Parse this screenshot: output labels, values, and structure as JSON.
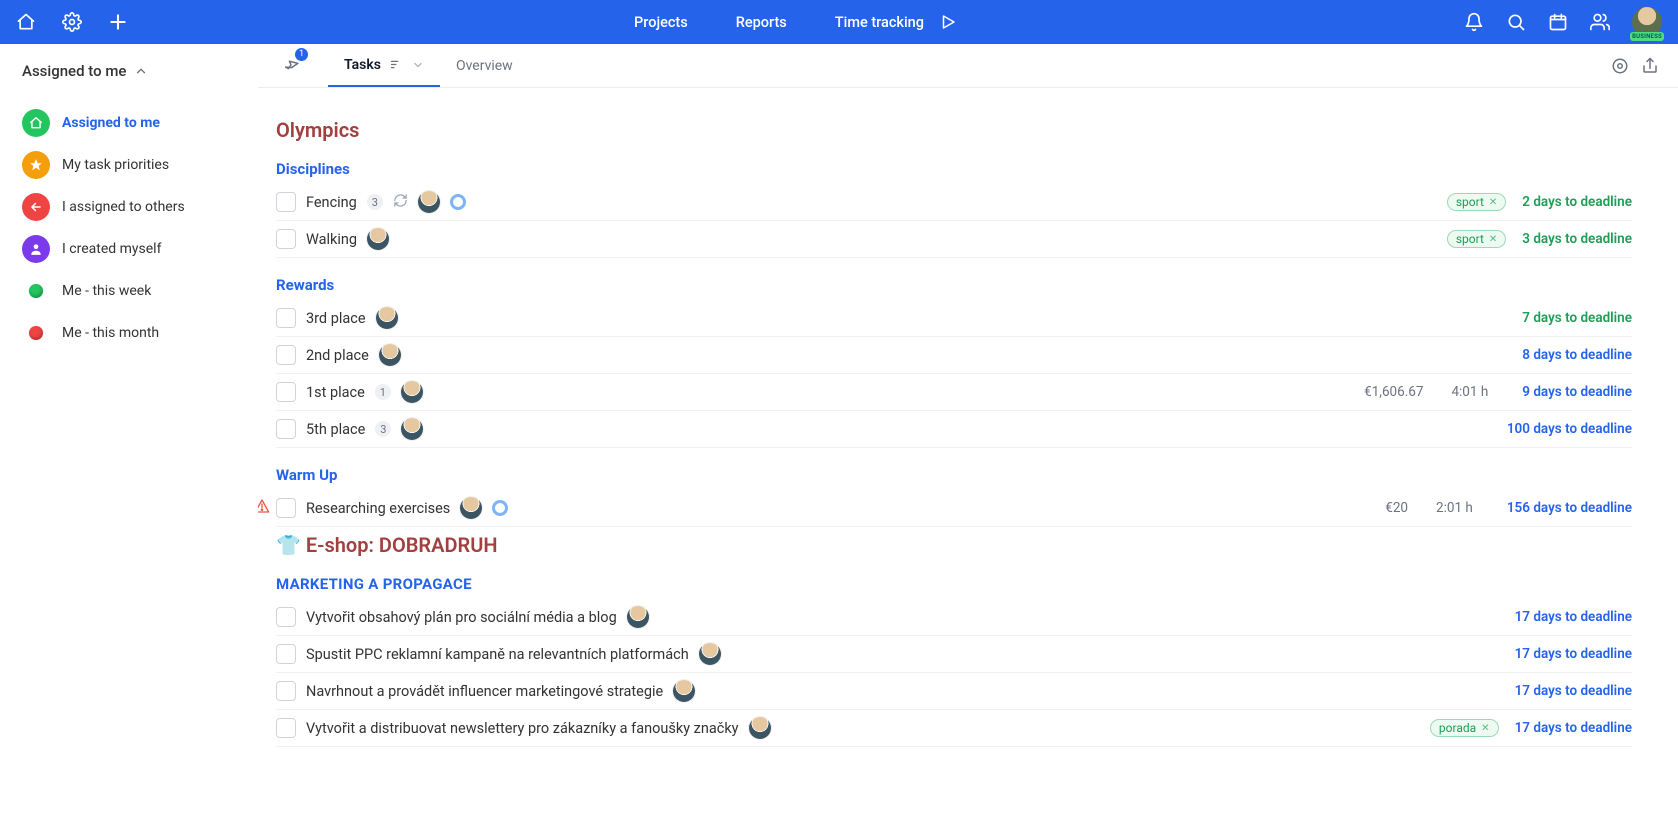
{
  "topbar": {
    "nav": {
      "projects": "Projects",
      "reports": "Reports",
      "time": "Time tracking"
    },
    "user_badge": "BUSINESS"
  },
  "sidebar": {
    "title": "Assigned to me",
    "items": [
      {
        "label": "Assigned to me",
        "active": true
      },
      {
        "label": "My task priorities",
        "active": false
      },
      {
        "label": "I assigned to others",
        "active": false
      },
      {
        "label": "I created myself",
        "active": false
      },
      {
        "label": "Me - this week",
        "active": false
      },
      {
        "label": "Me - this month",
        "active": false
      }
    ]
  },
  "viewbar": {
    "pin_badge": "1",
    "tabs": {
      "tasks": "Tasks",
      "overview": "Overview"
    }
  },
  "groups": [
    {
      "project": "Olympics",
      "project_emoji": "",
      "sections": [
        {
          "title": "Disciplines",
          "caps": false,
          "tasks": [
            {
              "warn": false,
              "name": "Fencing",
              "count": "3",
              "repeat": true,
              "solver": true,
              "ring": true,
              "tag": "sport",
              "money": "",
              "hours": "",
              "deadline": "2 days to deadline",
              "dc": "d-green"
            },
            {
              "warn": false,
              "name": "Walking",
              "count": "",
              "repeat": false,
              "solver": true,
              "ring": false,
              "tag": "sport",
              "money": "",
              "hours": "",
              "deadline": "3 days to deadline",
              "dc": "d-green"
            }
          ]
        },
        {
          "title": "Rewards",
          "caps": false,
          "tasks": [
            {
              "warn": false,
              "name": "3rd place",
              "count": "",
              "repeat": false,
              "solver": true,
              "ring": false,
              "tag": "",
              "money": "",
              "hours": "",
              "deadline": "7 days to deadline",
              "dc": "d-green"
            },
            {
              "warn": false,
              "name": "2nd place",
              "count": "",
              "repeat": false,
              "solver": true,
              "ring": false,
              "tag": "",
              "money": "",
              "hours": "",
              "deadline": "8 days to deadline",
              "dc": "d-blue"
            },
            {
              "warn": false,
              "name": "1st place",
              "count": "1",
              "repeat": false,
              "solver": true,
              "ring": false,
              "tag": "",
              "money": "€1,606.67",
              "hours": "4:01 h",
              "deadline": "9 days to deadline",
              "dc": "d-blue"
            },
            {
              "warn": false,
              "name": "5th place",
              "count": "3",
              "repeat": false,
              "solver": true,
              "ring": false,
              "tag": "",
              "money": "",
              "hours": "",
              "deadline": "100 days to deadline",
              "dc": "d-blue"
            }
          ]
        },
        {
          "title": "Warm Up",
          "caps": false,
          "tasks": [
            {
              "warn": true,
              "name": "Researching exercises",
              "count": "",
              "repeat": false,
              "solver": true,
              "ring": true,
              "tag": "",
              "money": "€20",
              "hours": "2:01 h",
              "deadline": "156 days to deadline",
              "dc": "d-blue"
            }
          ]
        }
      ]
    },
    {
      "project": "E-shop: DOBRADRUH",
      "project_emoji": "👕 ",
      "sections": [
        {
          "title": "MARKETING A PROPAGACE",
          "caps": true,
          "tasks": [
            {
              "warn": false,
              "name": "Vytvořit obsahový plán pro sociální média a blog",
              "count": "",
              "repeat": false,
              "solver": true,
              "ring": false,
              "tag": "",
              "money": "",
              "hours": "",
              "deadline": "17 days to deadline",
              "dc": "d-blue"
            },
            {
              "warn": false,
              "name": "Spustit PPC reklamní kampaně na relevantních platformách",
              "count": "",
              "repeat": false,
              "solver": true,
              "ring": false,
              "tag": "",
              "money": "",
              "hours": "",
              "deadline": "17 days to deadline",
              "dc": "d-blue"
            },
            {
              "warn": false,
              "name": "Navrhnout a provádět influencer marketingové strategie",
              "count": "",
              "repeat": false,
              "solver": true,
              "ring": false,
              "tag": "",
              "money": "",
              "hours": "",
              "deadline": "17 days to deadline",
              "dc": "d-blue"
            },
            {
              "warn": false,
              "name": "Vytvořit a distribuovat newslettery pro zákazníky a fanoušky značky",
              "count": "",
              "repeat": false,
              "solver": true,
              "ring": false,
              "tag": "porada",
              "money": "",
              "hours": "",
              "deadline": "17 days to deadline",
              "dc": "d-blue"
            }
          ]
        }
      ]
    }
  ]
}
